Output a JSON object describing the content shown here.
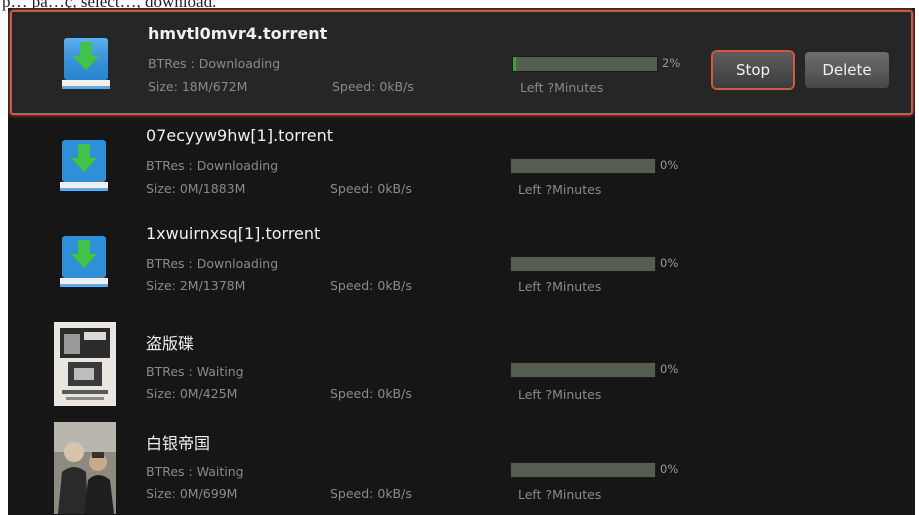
{
  "caption_text": "p… pa…ç, select…, download.",
  "buttons": {
    "stop": "Stop",
    "delete": "Delete"
  },
  "colors": {
    "selection_border": "#c85a48",
    "progress_fill": "#3ca03c",
    "progress_track": "#565d52"
  },
  "downloads": [
    {
      "title": "hmvtl0mvr4.torrent",
      "status": "BTRes : Downloading",
      "size": "Size:  18M/672M",
      "speed": "Speed: 0kB/s",
      "percent": "2%",
      "progress": 0.02,
      "time_left": "Left ?Minutes",
      "icon": "download-drive-icon"
    },
    {
      "title": "07ecyyw9hw[1].torrent",
      "status": "BTRes : Downloading",
      "size": "Size:  0M/1883M",
      "speed": "Speed: 0kB/s",
      "percent": "0%",
      "progress": 0.0,
      "time_left": "Left ?Minutes",
      "icon": "download-drive-icon"
    },
    {
      "title": "1xwuirnxsq[1].torrent",
      "status": "BTRes : Downloading",
      "size": "Size:  2M/1378M",
      "speed": "Speed: 0kB/s",
      "percent": "0%",
      "progress": 0.0,
      "time_left": "Left ?Minutes",
      "icon": "download-drive-icon"
    },
    {
      "title": "盗版碟",
      "status": "BTRes : Waiting",
      "size": "Size:  0M/425M",
      "speed": "Speed: 0kB/s",
      "percent": "0%",
      "progress": 0.0,
      "time_left": "Left ?Minutes",
      "icon": "movie-poster-thumbnail"
    },
    {
      "title": "白银帝国",
      "status": "BTRes : Waiting",
      "size": "Size:  0M/699M",
      "speed": "Speed: 0kB/s",
      "percent": "0%",
      "progress": 0.0,
      "time_left": "Left ?Minutes",
      "icon": "movie-poster-thumbnail"
    }
  ]
}
